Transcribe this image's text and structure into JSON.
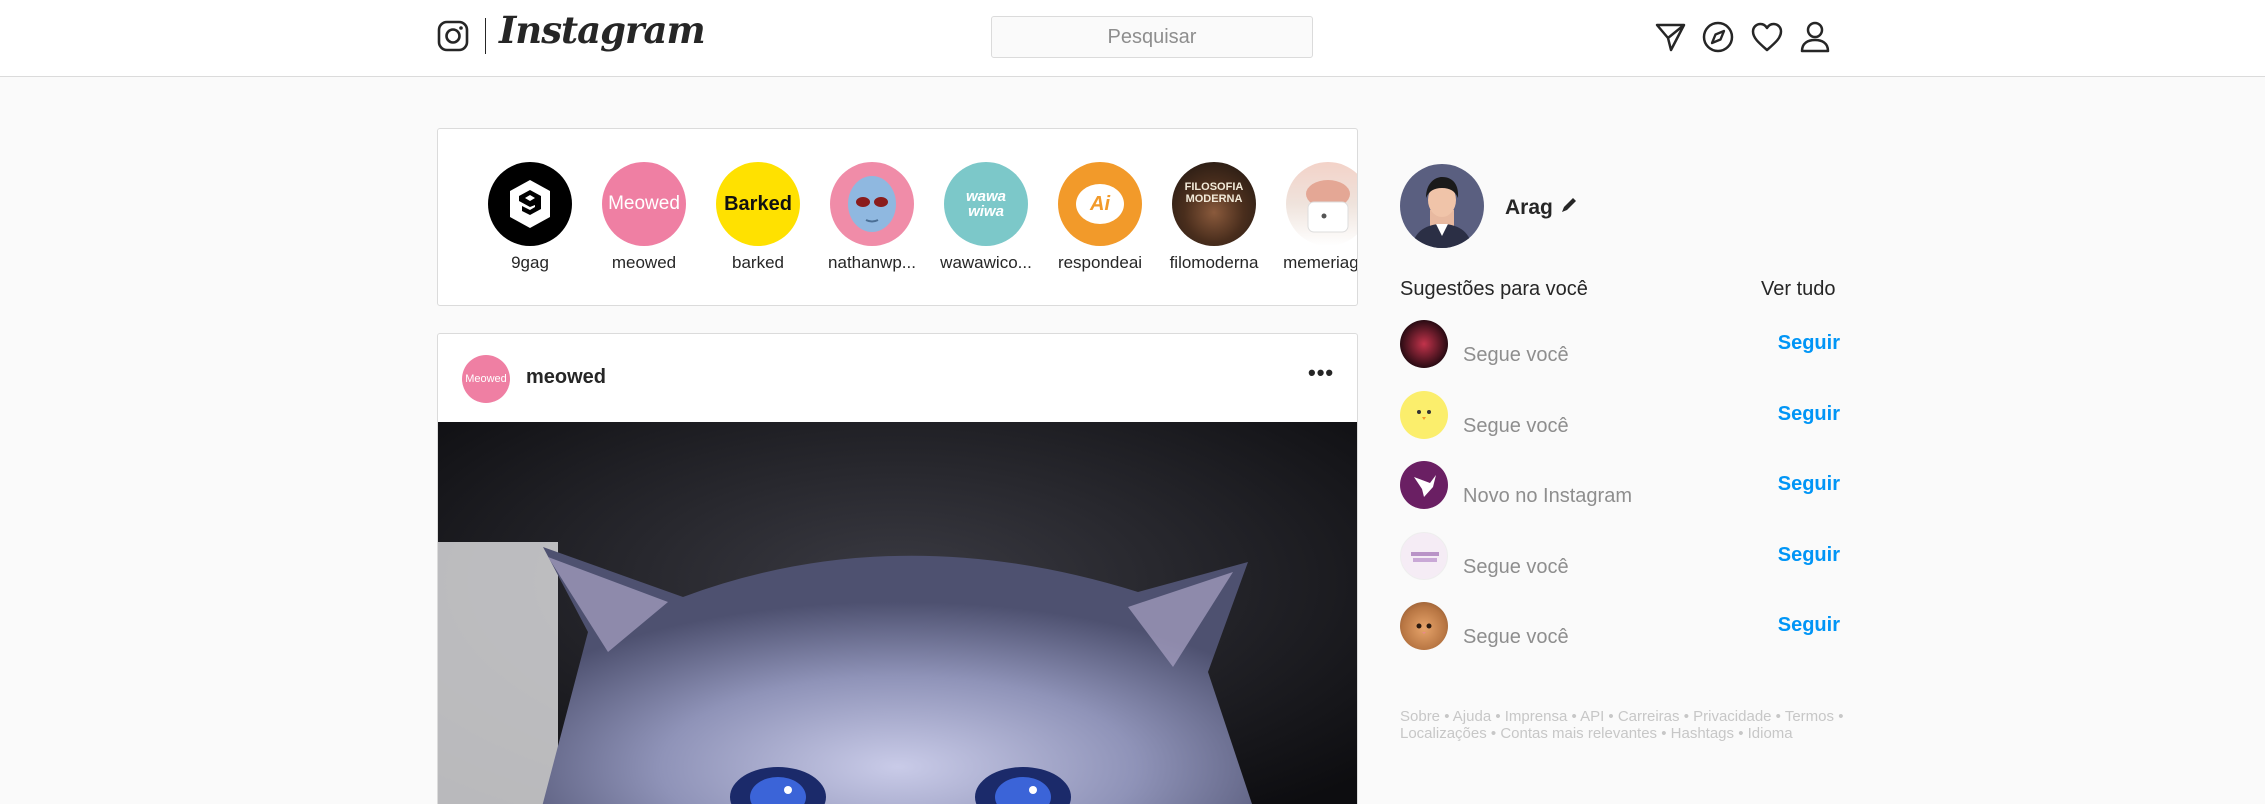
{
  "header": {
    "logo_text": "Instagram",
    "search_placeholder": "Pesquisar",
    "icons": [
      "direct-icon",
      "explore-icon",
      "heart-icon",
      "profile-icon"
    ]
  },
  "stories": [
    {
      "username": "9gag"
    },
    {
      "username": "meowed",
      "avatar_text": "Meowed"
    },
    {
      "username": "barked",
      "avatar_text": "Barked"
    },
    {
      "username": "nathanwp..."
    },
    {
      "username": "wawawico...",
      "avatar_text": "wawa wiwa"
    },
    {
      "username": "respondeai",
      "avatar_text": "Ai"
    },
    {
      "username": "filomoderna",
      "avatar_text": "FILOSOFIA MODERNA"
    },
    {
      "username": "memeriag..."
    }
  ],
  "post": {
    "username": "meowed",
    "avatar_text": "Meowed",
    "more_label": "•••"
  },
  "sidebar": {
    "profile_name": "Arag",
    "suggestions_title": "Sugestões para você",
    "see_all": "Ver tudo",
    "suggestions": [
      {
        "reason": "Segue você",
        "follow": "Seguir"
      },
      {
        "reason": "Segue você",
        "follow": "Seguir"
      },
      {
        "reason": "Novo no Instagram",
        "follow": "Seguir"
      },
      {
        "reason": "Segue você",
        "follow": "Seguir"
      },
      {
        "reason": "Segue você",
        "follow": "Seguir"
      }
    ],
    "footer": {
      "links": [
        "Sobre",
        "Ajuda",
        "Imprensa",
        "API",
        "Carreiras",
        "Privacidade",
        "Termos",
        "Localizações",
        "Contas mais relevantes",
        "Hashtags",
        "Idioma"
      ],
      "separator": " • "
    }
  },
  "colors": {
    "accent": "#0095f6",
    "border": "#dbdbdb",
    "background": "#fafafa",
    "muted_text": "#8e8e8e"
  }
}
